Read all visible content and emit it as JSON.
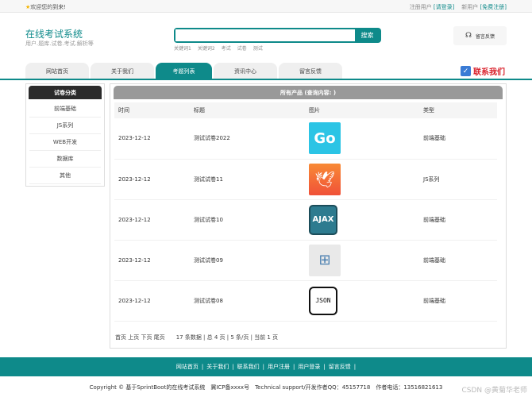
{
  "topbar": {
    "welcome": "欢迎您的到来!",
    "registered": "注册用户",
    "login": "[请登录]",
    "new_user": "新用户",
    "register": "[免费注册]"
  },
  "header": {
    "title": "在线考试系统",
    "subtitle": "用户.题库.试卷.考试.解析等",
    "search_button": "搜索",
    "search_value": "",
    "keywords": [
      "关键词1",
      "关键词2",
      "考试",
      "试卷",
      "测试"
    ],
    "feedback": "留言反馈"
  },
  "nav": {
    "tabs": [
      "网站首页",
      "关于我们",
      "考题列表",
      "资讯中心",
      "留言反馈"
    ],
    "active": 2,
    "contact": "联系我们"
  },
  "sidebar": {
    "title": "试卷分类",
    "items": [
      "前端基础",
      "JS系列",
      "WEB开发",
      "数据库",
      "其他"
    ]
  },
  "main": {
    "title": "所有产品 (查询内容: )",
    "columns": [
      "时间",
      "标题",
      "图片",
      "类型"
    ],
    "rows": [
      {
        "time": "2023-12-12",
        "title": "测试试卷2022",
        "image": "Go",
        "type": "前端基础"
      },
      {
        "time": "2023-12-12",
        "title": "测试试卷11",
        "image": "Swift",
        "type": "JS系列"
      },
      {
        "time": "2023-12-12",
        "title": "测试试卷10",
        "image": "AJAX",
        "type": "前端基础"
      },
      {
        "time": "2023-12-12",
        "title": "测试试卷09",
        "image": "tree",
        "type": "前端基础"
      },
      {
        "time": "2023-12-12",
        "title": "测试试卷08",
        "image": "JSON",
        "type": "前端基础"
      }
    ],
    "pager": {
      "links": "首页 上页 下页 尾页",
      "info": "17 条数据 | 总 4 页 | 5 条/页 | 当前 1 页"
    }
  },
  "footer": {
    "links": [
      "网站首页",
      "关于我们",
      "联系我们",
      "用户注册",
      "用户登录",
      "留言反馈"
    ],
    "copyright": "Copyright © 基于SprintBoot的在线考试系统　冀ICP备xxxx号　Technical support/开发作者QQ：45157718　作者电话：13516821613",
    "watermark": "CSDN @黄菊华老师"
  }
}
